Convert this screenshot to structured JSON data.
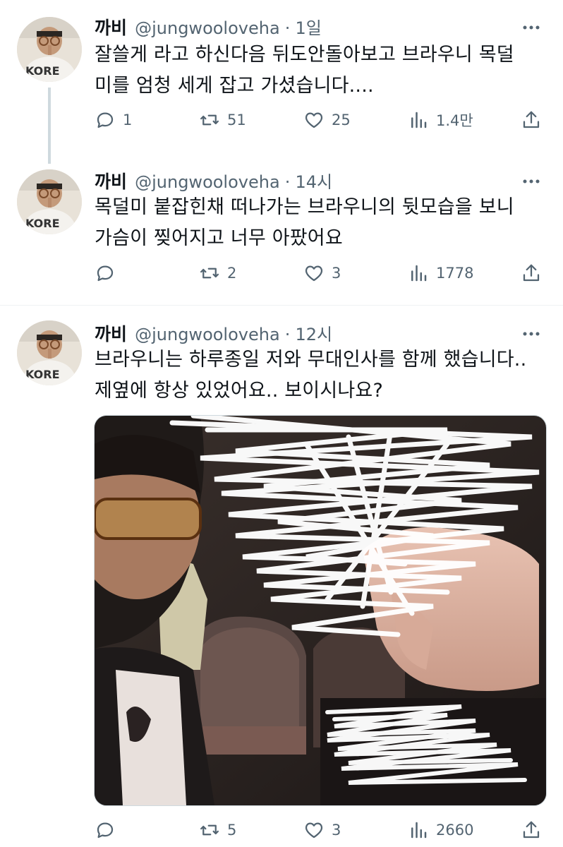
{
  "tweets": [
    {
      "name": "까비",
      "handle": "@jungwooloveha",
      "sep": "·",
      "time": "1일",
      "text": "잘쓸게 라고 하신다음 뒤도안돌아보고 브라우니 목덜\n미를 엄청 세게 잡고 가셨습니다....",
      "reply_count": "1",
      "retweet_count": "51",
      "like_count": "25",
      "view_count": "1.4만"
    },
    {
      "name": "까비",
      "handle": "@jungwooloveha",
      "sep": "·",
      "time": "14시",
      "text": "목덜미 붙잡힌채 떠나가는 브라우니의 뒷모습을 보니\n가슴이 찢어지고 너무 아팠어요",
      "reply_count": "",
      "retweet_count": "2",
      "like_count": "3",
      "view_count": "1778"
    },
    {
      "name": "까비",
      "handle": "@jungwooloveha",
      "sep": "·",
      "time": "12시",
      "text": "브라우니는 하루종일 저와 무대인사를 함께 했습니다..\n제옆에 항상 있었어요.. 보이시나요?",
      "reply_count": "",
      "retweet_count": "5",
      "like_count": "3",
      "view_count": "2660"
    }
  ],
  "avatar_shirt_text": "KORE",
  "icons": {
    "reply": "reply-icon",
    "retweet": "retweet-icon",
    "like": "heart-icon",
    "views": "views-icon",
    "share": "share-icon",
    "more": "more-icon"
  },
  "colors": {
    "text": "#0f1419",
    "secondary": "#536471",
    "border": "#eff3f4"
  }
}
